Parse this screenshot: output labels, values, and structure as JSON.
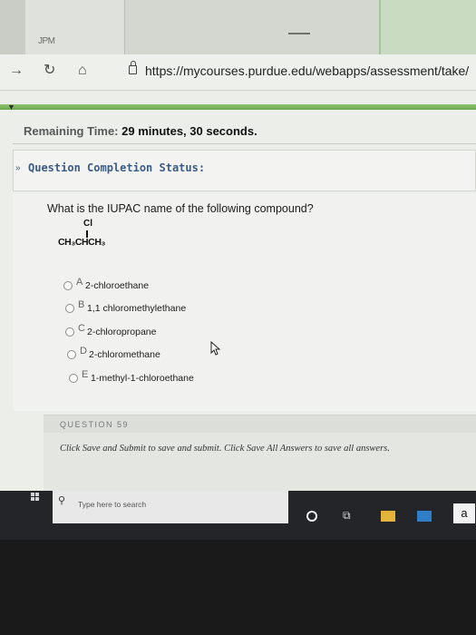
{
  "browser": {
    "tab_title": "JPM",
    "url": "https://mycourses.purdue.edu/webapps/assessment/take/",
    "icons": [
      "forward-icon",
      "refresh-icon",
      "home-icon",
      "lock-icon"
    ]
  },
  "timer": {
    "label": "Remaining Time:",
    "value": "29 minutes, 30 seconds."
  },
  "completion_status": {
    "label": "Question Completion Status:"
  },
  "question": {
    "text": "What is the IUPAC name of the following compound?",
    "compound": {
      "substituent": "Cl",
      "formula": "CH₃CHCH₃"
    },
    "options": [
      {
        "letter": "A",
        "text": "2-chloroethane"
      },
      {
        "letter": "B",
        "text": "1,1 chloromethylethane"
      },
      {
        "letter": "C",
        "text": "2-chloropropane"
      },
      {
        "letter": "D",
        "text": "2-chloromethane"
      },
      {
        "letter": "E",
        "text": "1-methyl-1-chloroethane"
      }
    ]
  },
  "next_question": {
    "label": "QUESTION 59"
  },
  "footer": {
    "message": "Click Save and Submit to save and submit. Click Save All Answers to save all answers."
  },
  "taskbar": {
    "search_placeholder": "Type here to search",
    "amazon_label": "a"
  },
  "colors": {
    "accent_green": "#6aa84f",
    "status_blue": "#3b5c86"
  }
}
